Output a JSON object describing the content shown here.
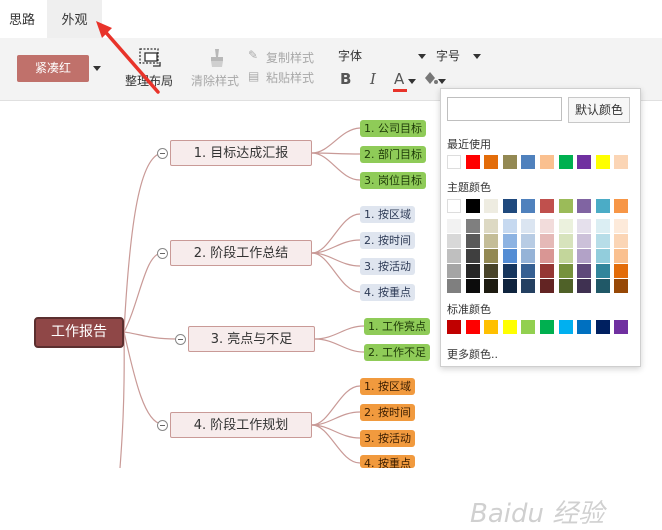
{
  "tabs": [
    "思路",
    "外观"
  ],
  "toolbar": {
    "style_button": "紧凑红",
    "layout_label": "整理布局",
    "clear_style": "清除样式",
    "copy_style": "复制样式",
    "paste_style": "粘贴样式",
    "font_label": "字体",
    "size_label": "字号",
    "bold": "B",
    "italic": "I",
    "font_color": "A"
  },
  "mindmap": {
    "root": "工作报告",
    "branches": [
      {
        "label": "1. 目标达成汇报",
        "leaves": [
          "1. 公司目标",
          "2. 部门目标",
          "3. 岗位目标"
        ],
        "leaf_style": "green"
      },
      {
        "label": "2. 阶段工作总结",
        "leaves": [
          "1. 按区域",
          "2. 按时间",
          "3. 按活动",
          "4. 按重点"
        ],
        "leaf_style": "blue"
      },
      {
        "label": "3. 亮点与不足",
        "leaves": [
          "1. 工作亮点",
          "2. 工作不足"
        ],
        "leaf_style": "green"
      },
      {
        "label": "4. 阶段工作规划",
        "leaves": [
          "1. 按区域",
          "2. 按时间",
          "3. 按活动",
          "4. 按重点"
        ],
        "leaf_style": "orange"
      }
    ]
  },
  "color_panel": {
    "hex_value": "",
    "default_button": "默认颜色",
    "recent_label": "最近使用",
    "theme_label": "主题颜色",
    "standard_label": "标准颜色",
    "more_label": "更多颜色..",
    "recent_colors": [
      "#ffffff",
      "#ff0000",
      "#e36c09",
      "#938953",
      "#4f81bd",
      "#fac08f",
      "#00b050",
      "#7030a0",
      "#ffff00",
      "#fbd5b5"
    ],
    "theme_top": [
      "#ffffff",
      "#000000",
      "#eeece1",
      "#1f497d",
      "#4f81bd",
      "#c0504d",
      "#9bbb59",
      "#8064a2",
      "#4bacc6",
      "#f79646"
    ],
    "theme_columns": [
      [
        "#f2f2f2",
        "#d8d8d8",
        "#bfbfbf",
        "#a5a5a5",
        "#7f7f7f"
      ],
      [
        "#7f7f7f",
        "#595959",
        "#3f3f3f",
        "#262626",
        "#0c0c0c"
      ],
      [
        "#ddd9c3",
        "#c4bd97",
        "#938953",
        "#494429",
        "#1d1b10"
      ],
      [
        "#c6d9f0",
        "#8db3e2",
        "#548dd4",
        "#17365d",
        "#0f243e"
      ],
      [
        "#dbe5f1",
        "#b8cce4",
        "#95b3d7",
        "#366092",
        "#244061"
      ],
      [
        "#f2dcdb",
        "#e5b9b7",
        "#d99694",
        "#953734",
        "#632423"
      ],
      [
        "#ebf1dd",
        "#d7e3bc",
        "#c3d69b",
        "#76923c",
        "#4f6128"
      ],
      [
        "#e5e0ec",
        "#ccc1d9",
        "#b2a2c7",
        "#5f497a",
        "#3f3151"
      ],
      [
        "#dbeef3",
        "#b7dde8",
        "#92cddc",
        "#31859b",
        "#205867"
      ],
      [
        "#fdeada",
        "#fbd5b5",
        "#fac08f",
        "#e36c09",
        "#974806"
      ]
    ],
    "standard_colors": [
      "#c00000",
      "#ff0000",
      "#ffc000",
      "#ffff00",
      "#92d050",
      "#00b050",
      "#00b0f0",
      "#0070c0",
      "#002060",
      "#7030a0"
    ]
  },
  "watermark": "Baidu 经验",
  "colors": {
    "accent": "#c0716b",
    "root_fill": "#8f4747",
    "node_fill": "#f7ecec",
    "connector": "#c99a97",
    "arrow": "#e8332a"
  }
}
